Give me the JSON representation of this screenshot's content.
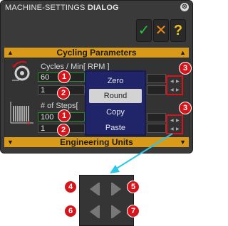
{
  "dialog": {
    "title_prefix": "MACHINE-SETTINGS",
    "title_suffix": "DIALOG",
    "close_glyph": "⊗",
    "buttons": {
      "ok_glyph": "✓",
      "cancel_glyph": "✕",
      "help_glyph": "?"
    }
  },
  "sections": {
    "cycling": "Cycling Parameters",
    "engineering": "Engineering Units"
  },
  "cycles": {
    "label": "Cycles / Min[ RPM ]",
    "value1": "60",
    "value2": "1"
  },
  "steps": {
    "label": "# of Steps[",
    "value1": "100",
    "value2": "1"
  },
  "context_menu": {
    "items": [
      "Zero",
      "Round",
      "Copy",
      "Paste"
    ],
    "selected": "Round"
  },
  "callouts": {
    "c1": "1",
    "c2": "2",
    "c3": "3",
    "c4": "4",
    "c5": "5",
    "c6": "6",
    "c7": "7"
  },
  "colors": {
    "section_bar": "#d89a18",
    "callout_red": "#d8141b",
    "ok_green": "#27c23a",
    "cancel_orange": "#f18a1a",
    "help_yellow": "#f2c21a",
    "pointer_cyan": "#29c8ea"
  }
}
